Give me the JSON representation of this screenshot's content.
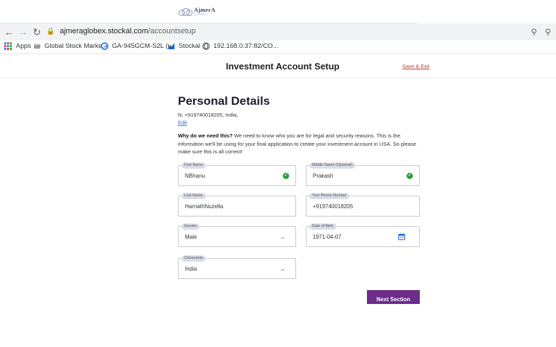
{
  "browser": {
    "url_host": "ajmeraglobex.stockal.com",
    "url_path": "/accountsetup",
    "bookmarks": [
      {
        "label": "Apps",
        "icon": "apps-grid-icon"
      },
      {
        "label": "Global Stock Marke...",
        "icon": "bookmark-page-icon"
      },
      {
        "label": "GA-945GCM-S2L (r...",
        "icon": "google-icon"
      },
      {
        "label": "Stockal",
        "icon": "stockal-icon"
      },
      {
        "label": "192.168.0.37:82/CO...",
        "icon": "globe-icon"
      }
    ]
  },
  "header": {
    "logo_text": "AjmerA",
    "logo_subtext": "globex",
    "title": "Investment Account Setup",
    "save_exit": "Save & Exit"
  },
  "form": {
    "title": "Personal Details",
    "contact_line": "N, +919740018205, India,",
    "edit_label": "Edit",
    "why_heading": "Why do we need this?",
    "why_text": " We need to know who you are for legal and security reasons. This is the information we'll be using for your final application to create your investment account in USA. So please make sure this is all correct!",
    "fields": {
      "first_name": {
        "label": "First Name",
        "value": "NBhanu"
      },
      "middle_name": {
        "label": "Middle Name (Optional)",
        "value": "Prakash"
      },
      "last_name": {
        "label": "Last Name",
        "value": "HarnathNuzella"
      },
      "phone": {
        "label": "Your Phone Number",
        "value": "+919740018205"
      },
      "gender": {
        "label": "Gender",
        "value": "Male"
      },
      "dob": {
        "label": "Date of Birth",
        "value": "1971-04-07"
      },
      "citizenship": {
        "label": "Citizenship",
        "value": "India"
      }
    },
    "next_label": "Next Section"
  },
  "colors": {
    "accent": "#6b2c8a",
    "success": "#2a9d3c",
    "link": "#2e6fd1",
    "save_exit": "#c0392b"
  }
}
